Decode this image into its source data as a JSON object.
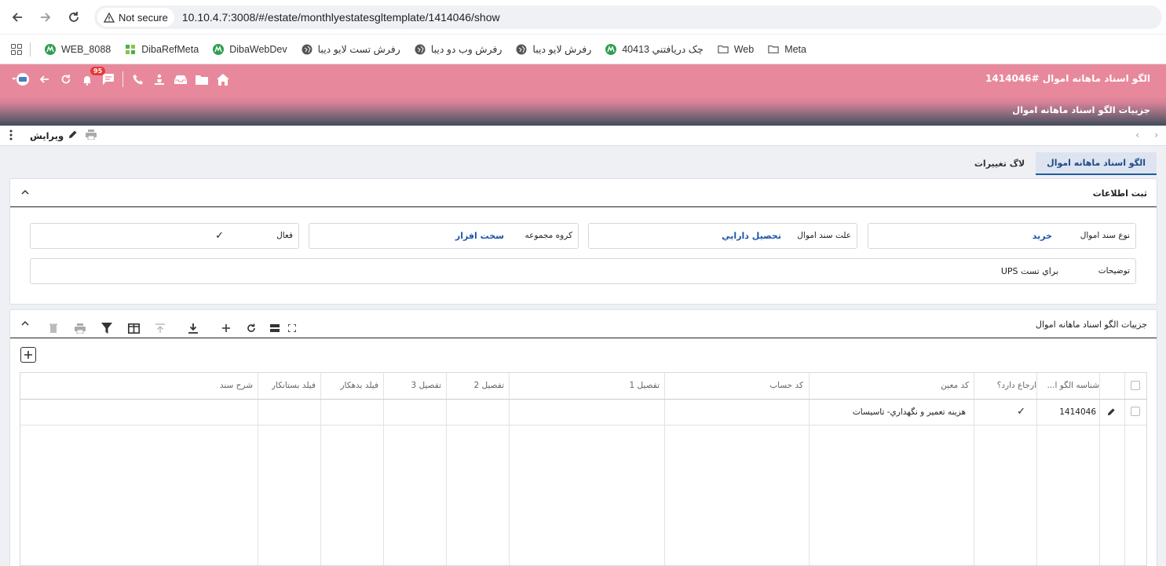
{
  "browser": {
    "security_label": "Not secure",
    "url": "10.10.4.7:3008/#/estate/monthlyestatesgltemplate/1414046/show"
  },
  "bookmarks": [
    {
      "label": "WEB_8088"
    },
    {
      "label": "DibaRefMeta"
    },
    {
      "label": "DibaWebDev"
    },
    {
      "label": "رفرش تست لایو دیبا"
    },
    {
      "label": "رفرش وب دو دیبا"
    },
    {
      "label": "رفرش لایو دیبا"
    },
    {
      "label": "چک دريافتني 40413"
    },
    {
      "label": "Web"
    },
    {
      "label": "Meta"
    }
  ],
  "header": {
    "title": "الگو اسناد ماهانه اموال  #1414046",
    "subtitle": "جزییات الگو اسناد ماهانه اموال",
    "notification_count": "95"
  },
  "toolbar": {
    "edit_label": "ویرایش"
  },
  "tabs": [
    {
      "label": "الگو اسناد ماهانه اموال",
      "active": true
    },
    {
      "label": "لاگ تغییرات",
      "active": false
    }
  ],
  "info_panel": {
    "title": "ثبت اطلاعات",
    "fields": {
      "doc_type": {
        "label": "نوع سند اموال",
        "value": "خريد"
      },
      "doc_reason": {
        "label": "علت سند اموال",
        "value": "تحصيل دارايي"
      },
      "group": {
        "label": "کروه مجموعه",
        "value": "سخت افزار"
      },
      "active": {
        "label": "فعال",
        "value": "✓"
      },
      "description": {
        "label": "توضیحات",
        "value": "براي تست UPS"
      }
    }
  },
  "details_panel": {
    "title": "جزییات الگو اسناد ماهانه اموال",
    "columns": {
      "id": "شناسه الگو ا...",
      "has_ref": "ارجاع دارد؟",
      "moein": "کد معین",
      "account": "کد حساب",
      "detail1": "تفصیل 1",
      "detail2": "تفصیل 2",
      "detail3": "تفصیل 3",
      "debtor": "فیلد بدهکار",
      "creditor": "فیلد بستانکار",
      "desc": "شرح سند"
    },
    "rows": [
      {
        "id": "1414046",
        "has_ref": "✓",
        "moein": "هزينه تعمير و نگهداري- تاسيسات",
        "account": "",
        "detail1": "",
        "detail2": "",
        "detail3": "",
        "debtor": "",
        "creditor": "",
        "desc": ""
      }
    ]
  }
}
